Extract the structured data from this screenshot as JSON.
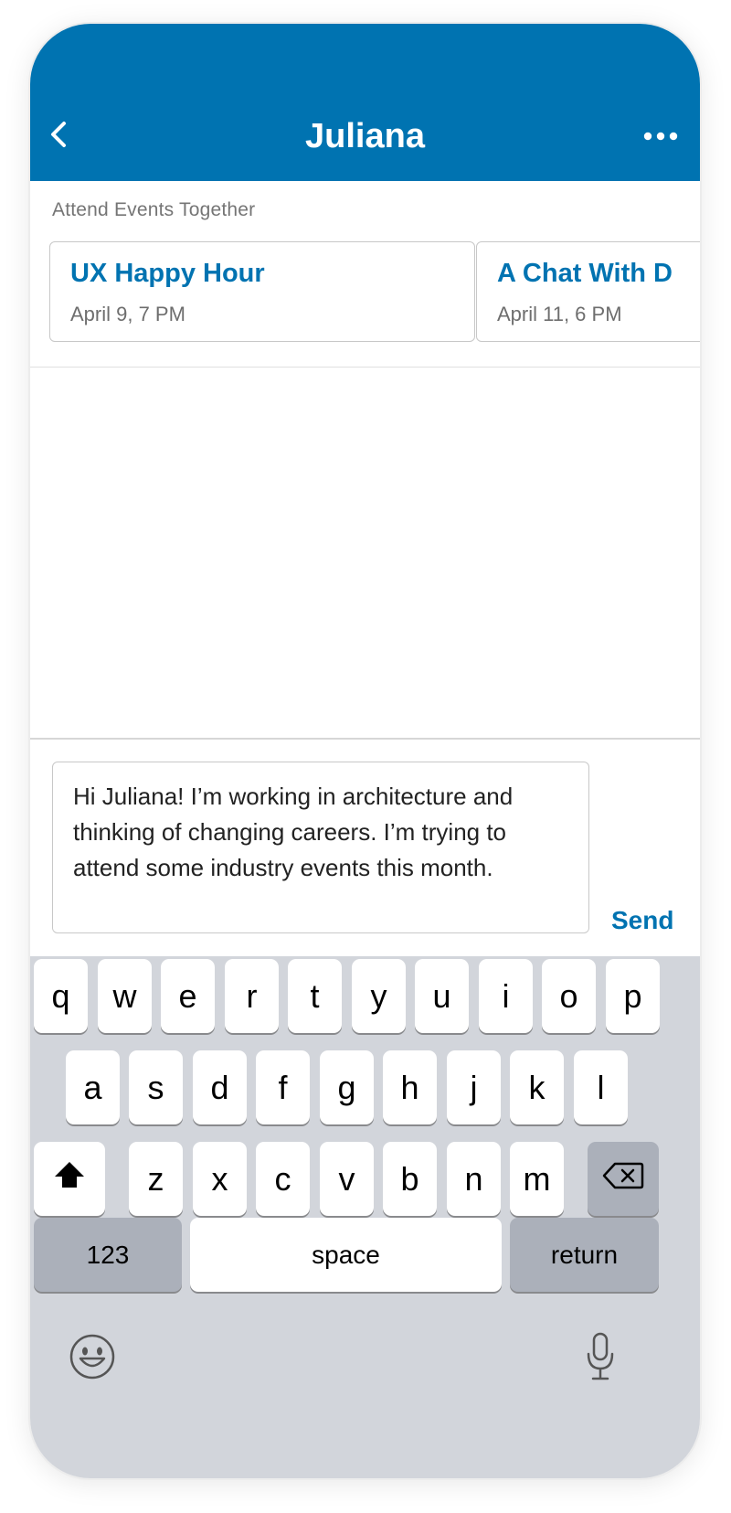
{
  "header": {
    "title": "Juliana",
    "bg_color": "#0073b1",
    "back_icon": "chevron-left-icon",
    "more_icon": "ellipsis-icon"
  },
  "events": {
    "section_label": "Attend Events Together",
    "cards": [
      {
        "title": "UX Happy Hour",
        "date": "April 9, 7 PM"
      },
      {
        "title": "A Chat With D",
        "date": "April 11, 6 PM"
      }
    ]
  },
  "composer": {
    "message": "Hi Juliana! I’m working in architecture and thinking of changing careers. I’m trying to attend some industry events this month.",
    "send_label": "Send"
  },
  "keyboard": {
    "row1": [
      "q",
      "w",
      "e",
      "r",
      "t",
      "y",
      "u",
      "i",
      "o",
      "p"
    ],
    "row2": [
      "a",
      "s",
      "d",
      "f",
      "g",
      "h",
      "j",
      "k",
      "l"
    ],
    "row3": [
      "z",
      "x",
      "c",
      "v",
      "b",
      "n",
      "m"
    ],
    "numbers_label": "123",
    "space_label": "space",
    "return_label": "return",
    "shift_icon": "shift-arrow-icon",
    "delete_icon": "backspace-icon",
    "emoji_icon": "emoji-icon",
    "mic_icon": "microphone-icon"
  }
}
